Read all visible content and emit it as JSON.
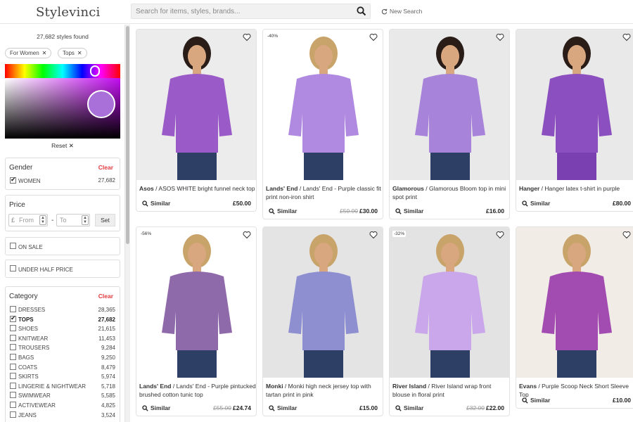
{
  "header": {
    "logo": "Stylevinci",
    "search_placeholder": "Search for items, styles, brands...",
    "new_search": "New Search"
  },
  "sidebar": {
    "styles_found": "27,682 styles found",
    "chips": [
      {
        "label": "For Women"
      },
      {
        "label": "Tops"
      }
    ],
    "color_picker": {
      "hue_color": "#c20cf0",
      "selected_color": "#a870d8"
    },
    "reset_label": "Reset",
    "gender": {
      "title": "Gender",
      "clear": "Clear",
      "options": [
        {
          "label": "WOMEN",
          "count": "27,682",
          "checked": true
        }
      ]
    },
    "price": {
      "title": "Price",
      "currency": "£",
      "from_placeholder": "From",
      "dash": "-",
      "to_placeholder": "To",
      "set_label": "Set"
    },
    "on_sale": "ON SALE",
    "under_half_price": "UNDER HALF PRICE",
    "category": {
      "title": "Category",
      "clear": "Clear",
      "items": [
        {
          "label": "DRESSES",
          "count": "28,365",
          "checked": false
        },
        {
          "label": "TOPS",
          "count": "27,682",
          "checked": true
        },
        {
          "label": "SHOES",
          "count": "21,615",
          "checked": false
        },
        {
          "label": "KNITWEAR",
          "count": "11,453",
          "checked": false
        },
        {
          "label": "TROUSERS",
          "count": "9,284",
          "checked": false
        },
        {
          "label": "BAGS",
          "count": "9,250",
          "checked": false
        },
        {
          "label": "COATS",
          "count": "8,479",
          "checked": false
        },
        {
          "label": "SKIRTS",
          "count": "5,974",
          "checked": false
        },
        {
          "label": "LINGERIE & NIGHTWEAR",
          "count": "5,718",
          "checked": false
        },
        {
          "label": "SWIMWEAR",
          "count": "5,585",
          "checked": false
        },
        {
          "label": "ACTIVEWEAR",
          "count": "4,825",
          "checked": false
        },
        {
          "label": "JEANS",
          "count": "3,524",
          "checked": false
        }
      ]
    }
  },
  "products": [
    {
      "brand": "Asos",
      "name": "ASOS WHITE bright funnel neck top",
      "old_price": "",
      "price": "£50.00",
      "discount": "",
      "similar": "Similar",
      "bg": "#ececec",
      "garment": "#9a5ac8"
    },
    {
      "brand": "Lands' End",
      "name": "Lands' End - Purple classic fit print non-iron shirt",
      "old_price": "£50.00",
      "price": "£30.00",
      "discount": "-40%",
      "similar": "Similar",
      "bg": "#ffffff",
      "garment": "#b08ae0"
    },
    {
      "brand": "Glamorous",
      "name": "Glamorous Bloom top in mini spot print",
      "old_price": "",
      "price": "£16.00",
      "discount": "",
      "similar": "Similar",
      "bg": "#e9e9e9",
      "garment": "#a883da"
    },
    {
      "brand": "Hanger",
      "name": "Hanger latex t-shirt in purple",
      "old_price": "",
      "price": "£80.00",
      "discount": "",
      "similar": "Similar",
      "bg": "#e9e9e9",
      "garment": "#8b4fc0"
    },
    {
      "brand": "Lands' End",
      "name": "Lands' End - Purple pintucked brushed cotton tunic top",
      "old_price": "£55.00",
      "price": "£24.74",
      "discount": "-56%",
      "similar": "Similar",
      "bg": "#ffffff",
      "garment": "#8e6aaa"
    },
    {
      "brand": "Monki",
      "name": "Monki high neck jersey top with tartan print in pink",
      "old_price": "",
      "price": "£15.00",
      "discount": "",
      "similar": "Similar",
      "bg": "#e4e4e4",
      "garment": "#8e8fd0"
    },
    {
      "brand": "River Island",
      "name": "River Island wrap front blouse in floral print",
      "old_price": "£32.00",
      "price": "£22.00",
      "discount": "-32%",
      "similar": "Similar",
      "bg": "#e3e3e3",
      "garment": "#c9a7ea"
    },
    {
      "brand": "Evans",
      "name": "Purple Scoop Neck Short Sleeve Top",
      "old_price": "",
      "price": "£10.00",
      "discount": "",
      "similar": "Similar",
      "bg": "#f1ece6",
      "garment": "#a24bb0"
    }
  ]
}
